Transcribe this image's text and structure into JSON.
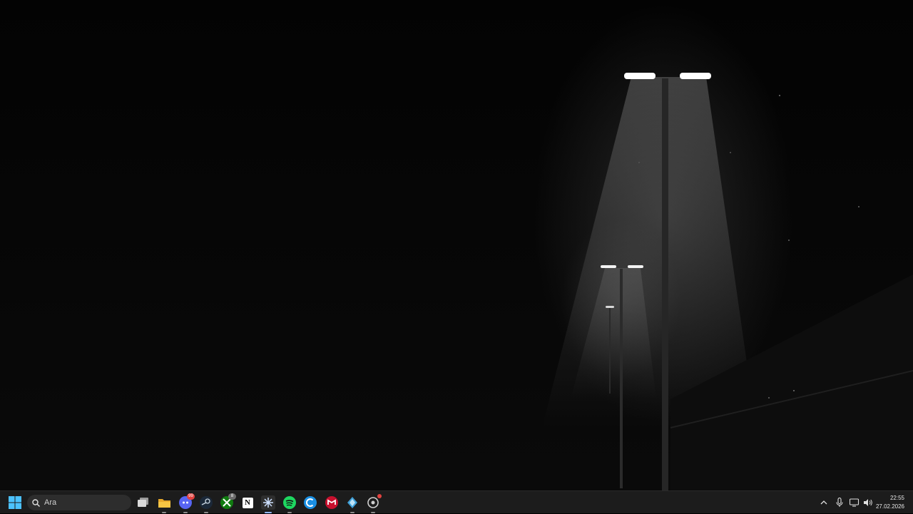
{
  "desktop": {
    "wallpaper": "foggy-street-lamps-at-night"
  },
  "taskbar": {
    "search": {
      "placeholder": "Ara"
    },
    "apps": [
      {
        "name": "task-view",
        "icon": "task-view-icon"
      },
      {
        "name": "file-explorer",
        "icon": "folder-icon"
      },
      {
        "name": "discord",
        "icon": "discord-icon",
        "badge": "99"
      },
      {
        "name": "steam",
        "icon": "steam-icon"
      },
      {
        "name": "xbox",
        "icon": "xbox-icon",
        "badge": "8"
      },
      {
        "name": "notion",
        "icon": "notion-icon",
        "letter": "N"
      },
      {
        "name": "perplexity",
        "icon": "perplexity-icon",
        "active": true
      },
      {
        "name": "spotify",
        "icon": "spotify-icon"
      },
      {
        "name": "copilot",
        "icon": "copilot-icon"
      },
      {
        "name": "mcafee",
        "icon": "mcafee-icon"
      },
      {
        "name": "kaspersky",
        "icon": "shield-icon"
      },
      {
        "name": "opera-gx",
        "icon": "browser-icon"
      }
    ],
    "tray": {
      "time": "22:55",
      "date": "27.02.2026"
    }
  },
  "colors": {
    "taskbar_bg": "#1c1c1c",
    "accent": "#8fb6ff",
    "badge": "#e2423f"
  }
}
